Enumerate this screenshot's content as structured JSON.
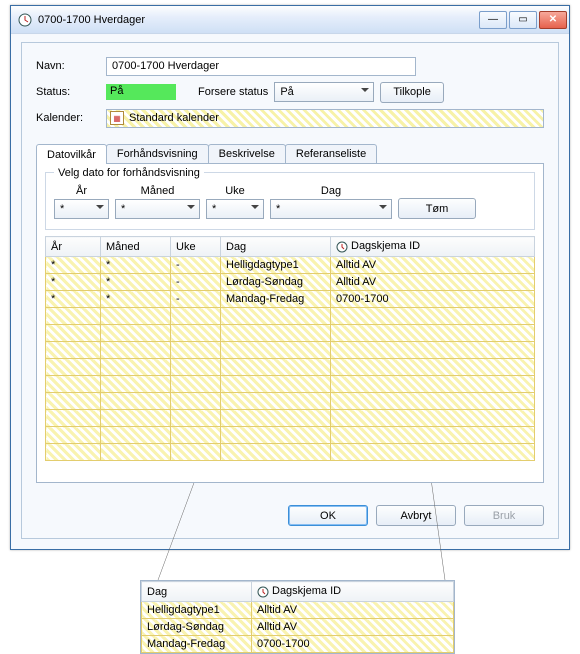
{
  "window": {
    "title": "0700-1700 Hverdager"
  },
  "form": {
    "name_label": "Navn:",
    "name_value": "0700-1700 Hverdager",
    "status_label": "Status:",
    "status_value": "På",
    "force_label": "Forsere status",
    "force_value": "På",
    "connect_btn": "Tilkople",
    "calendar_label": "Kalender:",
    "calendar_value": "Standard kalender"
  },
  "tabs": {
    "t1": "Datovilkår",
    "t2": "Forhåndsvisning",
    "t3": "Beskrivelse",
    "t4": "Referanseliste"
  },
  "preview": {
    "legend": "Velg dato for forhåndsvisning",
    "year": "År",
    "month": "Måned",
    "week": "Uke",
    "day": "Dag",
    "clear_btn": "Tøm",
    "wild": "*"
  },
  "grid": {
    "headers": {
      "year": "År",
      "month": "Måned",
      "week": "Uke",
      "day": "Dag",
      "sched": "Dagskjema ID"
    },
    "rows": [
      {
        "year": "*",
        "month": "*",
        "week": "-",
        "day": "Helligdagtype1",
        "sched": "Alltid AV"
      },
      {
        "year": "*",
        "month": "*",
        "week": "-",
        "day": "Lørdag-Søndag",
        "sched": "Alltid AV"
      },
      {
        "year": "*",
        "month": "*",
        "week": "-",
        "day": "Mandag-Fredag",
        "sched": "0700-1700"
      }
    ]
  },
  "buttons": {
    "ok": "OK",
    "cancel": "Avbryt",
    "apply": "Bruk"
  },
  "zoom": {
    "headers": {
      "day": "Dag",
      "sched": "Dagskjema ID"
    },
    "rows": [
      {
        "day": "Helligdagtype1",
        "sched": "Alltid AV"
      },
      {
        "day": "Lørdag-Søndag",
        "sched": "Alltid AV"
      },
      {
        "day": "Mandag-Fredag",
        "sched": "0700-1700"
      }
    ]
  }
}
